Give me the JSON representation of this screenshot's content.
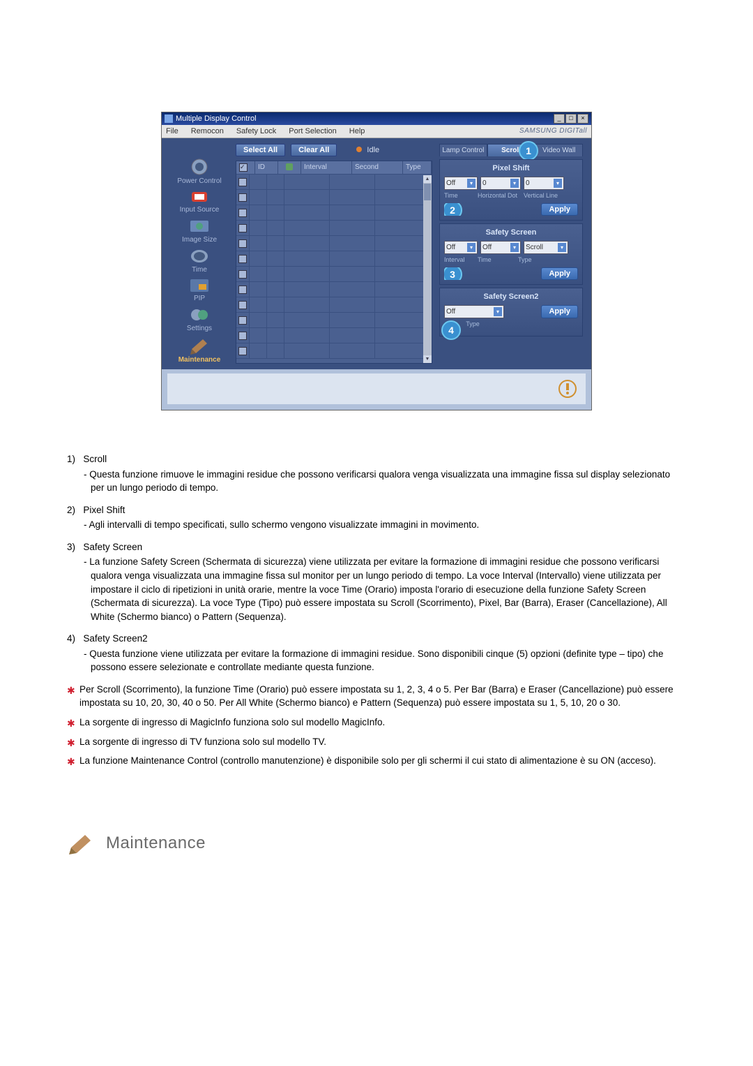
{
  "app": {
    "title": "Multiple Display Control",
    "brand": "SAMSUNG DIGITall"
  },
  "menu": {
    "file": "File",
    "remocon": "Remocon",
    "safety_lock": "Safety Lock",
    "port_selection": "Port Selection",
    "help": "Help"
  },
  "sidebar": {
    "items": [
      {
        "label": "Power Control"
      },
      {
        "label": "Input Source"
      },
      {
        "label": "Image Size"
      },
      {
        "label": "Time"
      },
      {
        "label": "PIP"
      },
      {
        "label": "Settings"
      },
      {
        "label": "Maintenance"
      }
    ]
  },
  "toolbar": {
    "select_all": "Select All",
    "clear_all": "Clear All",
    "idle": "Idle"
  },
  "table": {
    "headers": {
      "id": "ID",
      "interval": "Interval",
      "second": "Second",
      "type": "Type"
    }
  },
  "rightpanel": {
    "tabs": {
      "lamp": "Lamp Control",
      "scroll": "Scroll",
      "videowall": "Video Wall"
    },
    "pixel_shift": {
      "title": "Pixel Shift",
      "time": "Off",
      "hdot": "0",
      "vline": "0",
      "labels": {
        "time": "Time",
        "hdot": "Horizontal Dot",
        "vline": "Vertical Line"
      },
      "apply": "Apply"
    },
    "safety_screen": {
      "title": "Safety Screen",
      "interval": "Off",
      "time": "Off",
      "type": "Scroll",
      "labels": {
        "interval": "Interval",
        "time": "Time",
        "type": "Type"
      },
      "apply": "Apply"
    },
    "safety_screen2": {
      "title": "Safety Screen2",
      "type": "Off",
      "labels": {
        "type": "Type"
      },
      "apply": "Apply"
    }
  },
  "desc": {
    "items": [
      {
        "num": "1)",
        "title": "Scroll",
        "body": "- Questa funzione rimuove le immagini residue che possono verificarsi qualora venga visualizzata una immagine fissa sul display selezionato per un lungo periodo di tempo."
      },
      {
        "num": "2)",
        "title": "Pixel Shift",
        "body": "- Agli intervalli di tempo specificati, sullo schermo vengono visualizzate immagini in movimento."
      },
      {
        "num": "3)",
        "title": "Safety Screen",
        "body": "- La funzione Safety Screen (Schermata di sicurezza) viene utilizzata per evitare la formazione di immagini residue che possono verificarsi qualora venga visualizzata una immagine fissa sul monitor per un lungo periodo di tempo. La voce Interval (Intervallo) viene utilizzata per impostare il ciclo di ripetizioni in unità orarie, mentre la voce Time (Orario) imposta l'orario di esecuzione della funzione Safety Screen (Schermata di sicurezza). La voce Type (Tipo) può essere impostata su Scroll (Scorrimento), Pixel, Bar (Barra), Eraser (Cancellazione), All White (Schermo bianco) o Pattern (Sequenza)."
      },
      {
        "num": "4)",
        "title": "Safety Screen2",
        "body": "- Questa funzione viene utilizzata per evitare la formazione di immagini residue. Sono disponibili cinque (5) opzioni (definite type – tipo) che possono essere selezionate e controllate mediante questa funzione."
      }
    ],
    "notes": [
      "Per Scroll (Scorrimento), la funzione Time (Orario) può essere impostata su 1, 2, 3, 4 o 5. Per Bar (Barra) e Eraser (Cancellazione) può essere impostata su 10, 20, 30, 40 o 50. Per All White (Schermo bianco) e Pattern (Sequenza) può essere impostata su 1, 5, 10, 20 o 30.",
      "La sorgente di ingresso di MagicInfo funziona solo sul modello MagicInfo.",
      "La sorgente di ingresso di TV funziona solo sul modello TV.",
      "La funzione Maintenance Control (controllo manutenzione) è disponibile solo per gli schermi il cui stato di alimentazione è su ON (acceso)."
    ]
  },
  "section_heading": "Maintenance"
}
